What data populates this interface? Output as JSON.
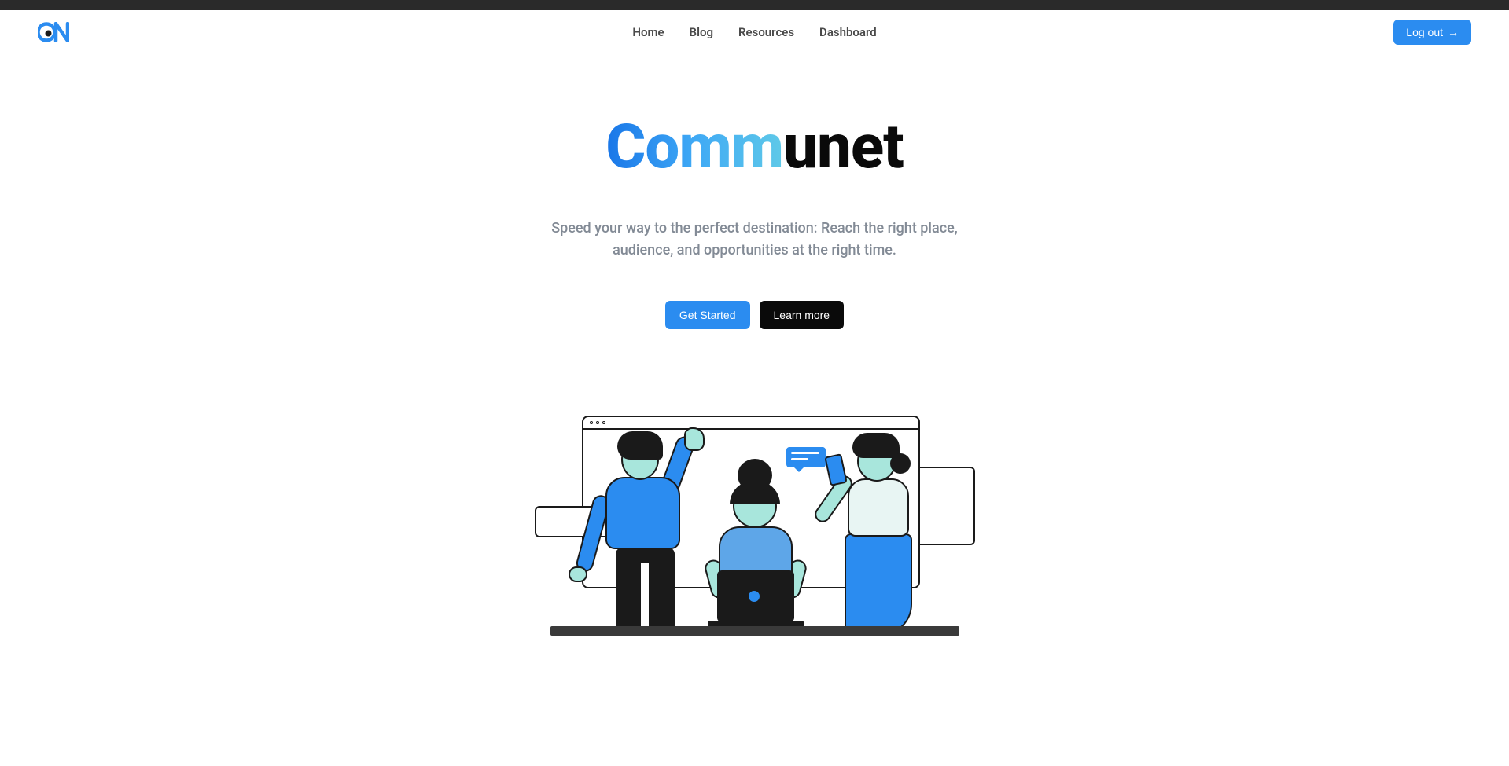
{
  "nav": {
    "items": [
      {
        "label": "Home"
      },
      {
        "label": "Blog"
      },
      {
        "label": "Resources"
      },
      {
        "label": "Dashboard"
      }
    ]
  },
  "header": {
    "logout_label": "Log out"
  },
  "hero": {
    "title_part1": "Comm",
    "title_part2": "unet",
    "subtitle": "Speed your way to the perfect destination: Reach the right place, audience, and opportunities at the right time.",
    "cta_primary": "Get Started",
    "cta_secondary": "Learn more"
  }
}
